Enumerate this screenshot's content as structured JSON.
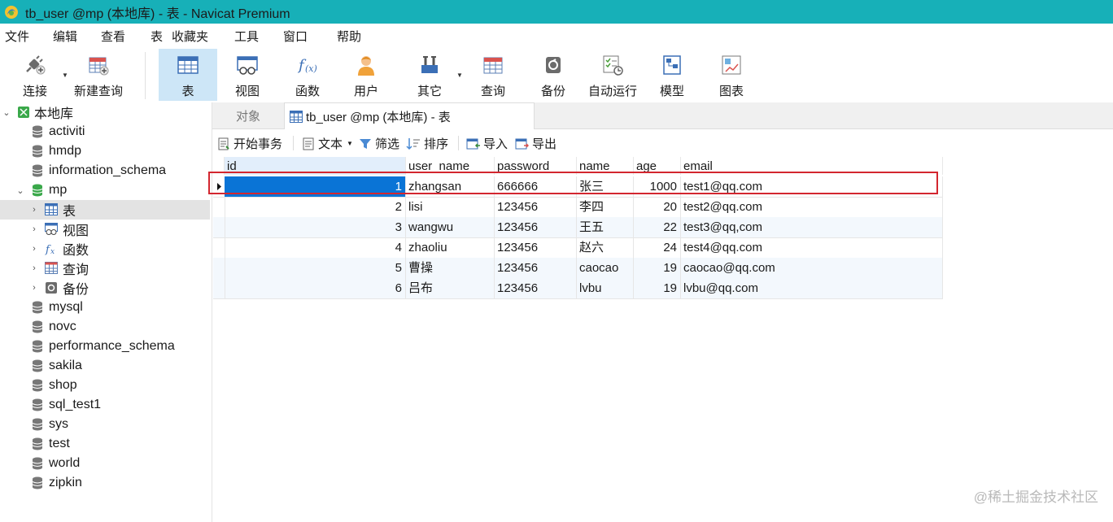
{
  "window": {
    "title": "tb_user @mp (本地库) - 表 - Navicat Premium"
  },
  "menu": [
    "文件",
    "编辑",
    "查看",
    "表",
    "收藏夹",
    "工具",
    "窗口",
    "帮助"
  ],
  "toolbar": {
    "connect": "连接",
    "new_query": "新建查询",
    "table": "表",
    "view": "视图",
    "function": "函数",
    "user": "用户",
    "other": "其它",
    "query": "查询",
    "backup": "备份",
    "automation": "自动运行",
    "model": "模型",
    "chart": "图表"
  },
  "sidebar": {
    "root": "本地库",
    "databases": [
      "activiti",
      "hmdp",
      "information_schema",
      "mp"
    ],
    "mp_children": [
      "表",
      "视图",
      "函数",
      "查询",
      "备份"
    ],
    "databases_after": [
      "mysql",
      "novc",
      "performance_schema",
      "sakila",
      "shop",
      "sql_test1",
      "sys",
      "test",
      "world",
      "zipkin"
    ]
  },
  "tabs": {
    "objects": "对象",
    "current": "tb_user @mp (本地库) - 表"
  },
  "data_toolbar": {
    "begin_transaction": "开始事务",
    "text": "文本",
    "filter": "筛选",
    "sort": "排序",
    "import": "导入",
    "export": "导出"
  },
  "table": {
    "columns": [
      "id",
      "user_name",
      "password",
      "name",
      "age",
      "email"
    ],
    "rows": [
      [
        "1",
        "zhangsan",
        "666666",
        "张三",
        "1000",
        "test1@qq.com"
      ],
      [
        "2",
        "lisi",
        "123456",
        "李四",
        "20",
        "test2@qq.com"
      ],
      [
        "3",
        "wangwu",
        "123456",
        "王五",
        "22",
        "test3@qq,com"
      ],
      [
        "4",
        "zhaoliu",
        "123456",
        "赵六",
        "24",
        "test4@qq.com"
      ],
      [
        "5",
        "曹操",
        "123456",
        "caocao",
        "19",
        "caocao@qq.com"
      ],
      [
        "6",
        "吕布",
        "123456",
        "lvbu",
        "19",
        "lvbu@qq.com"
      ]
    ]
  },
  "watermark": "@稀土掘金技术社区",
  "colors": {
    "titlebar": "#17b0b8",
    "selection": "#0a74d6",
    "highlight_box": "#d3262f",
    "active_tool": "#cde6f7"
  }
}
